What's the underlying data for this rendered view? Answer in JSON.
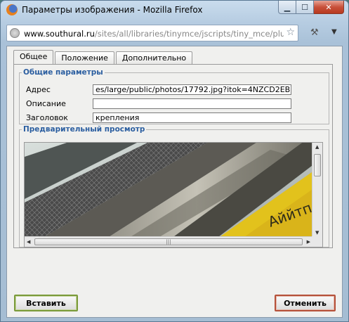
{
  "window": {
    "title": "Параметры изображения - Mozilla Firefox",
    "url_host": "www.southural.ru",
    "url_path": "/sites/all/libraries/tinymce/jscripts/tiny_mce/plugir",
    "controls": {
      "minimize": "▁",
      "maximize": "☐",
      "close": "✕"
    }
  },
  "toolbar": {
    "star": "☆",
    "dropdown": "▼",
    "addon": "⚒"
  },
  "tabs": [
    {
      "label": "Общее"
    },
    {
      "label": "Положение"
    },
    {
      "label": "Дополнительно"
    }
  ],
  "general": {
    "legend": "Общие параметры",
    "address_label": "Адрес",
    "address_value": "es/large/public/photos/17792.jpg?itok=4NZCD2EB",
    "description_label": "Описание",
    "description_value": "",
    "title_label": "Заголовок",
    "title_value": "крепления"
  },
  "preview": {
    "legend": "Предварительный просмотр",
    "scroll_up": "▲",
    "scroll_down": "▼",
    "scroll_left": "◀",
    "scroll_right": "▶",
    "grip": "|||"
  },
  "buttons": {
    "insert": "Вставить",
    "cancel": "Отменить"
  }
}
